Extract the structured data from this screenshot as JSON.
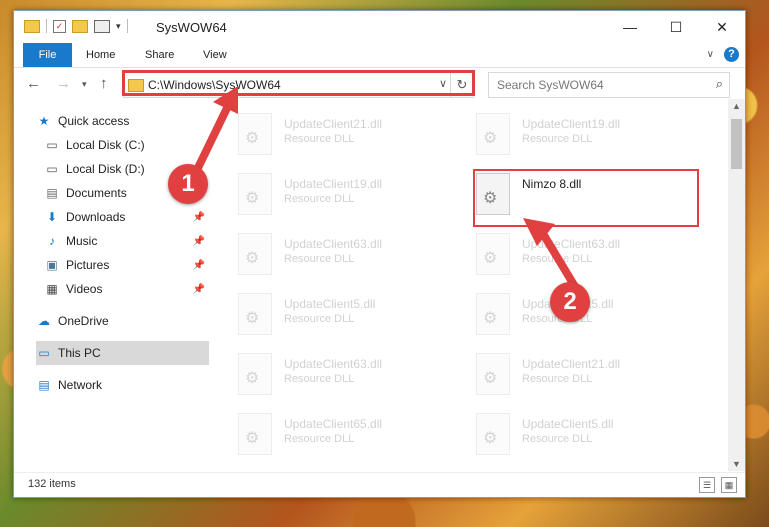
{
  "window": {
    "title": "SysWOW64"
  },
  "ribbon": {
    "tabs": [
      "File",
      "Home",
      "Share",
      "View"
    ]
  },
  "address": {
    "path": "C:\\Windows\\SysWOW64"
  },
  "search": {
    "placeholder": "Search SysWOW64"
  },
  "sidebar": {
    "items": [
      {
        "label": "Quick access",
        "icon": "star-icon"
      },
      {
        "label": "Local Disk (C:)",
        "icon": "drive-icon"
      },
      {
        "label": "Local Disk (D:)",
        "icon": "drive-icon"
      },
      {
        "label": "Documents",
        "icon": "documents-icon"
      },
      {
        "label": "Downloads",
        "icon": "download-icon"
      },
      {
        "label": "Music",
        "icon": "music-icon"
      },
      {
        "label": "Pictures",
        "icon": "pictures-icon"
      },
      {
        "label": "Videos",
        "icon": "videos-icon"
      },
      {
        "label": "OneDrive",
        "icon": "cloud-icon"
      },
      {
        "label": "This PC",
        "icon": "computer-icon"
      },
      {
        "label": "Network",
        "icon": "network-icon"
      }
    ]
  },
  "files": [
    {
      "name": "UpdateClient21.dll",
      "type": "Resource DLL"
    },
    {
      "name": "UpdateClient19.dll",
      "type": "Resource DLL"
    },
    {
      "name": "UpdateClient19.dll",
      "type": "Resource DLL"
    },
    {
      "name": "Nimzo 8.dll",
      "type": ""
    },
    {
      "name": "UpdateClient63.dll",
      "type": "Resource DLL"
    },
    {
      "name": "UpdateClient63.dll",
      "type": "Resource DLL"
    },
    {
      "name": "UpdateClient5.dll",
      "type": "Resource DLL"
    },
    {
      "name": "UpdateClient5.dll",
      "type": "Resource DLL"
    },
    {
      "name": "UpdateClient63.dll",
      "type": "Resource DLL"
    },
    {
      "name": "UpdateClient21.dll",
      "type": "Resource DLL"
    },
    {
      "name": "UpdateClient65.dll",
      "type": "Resource DLL"
    },
    {
      "name": "UpdateClient5.dll",
      "type": "Resource DLL"
    }
  ],
  "status": {
    "count": "132 items"
  },
  "callouts": [
    "1",
    "2"
  ],
  "colors": {
    "accent": "#1979ca",
    "highlight": "#e04040"
  }
}
